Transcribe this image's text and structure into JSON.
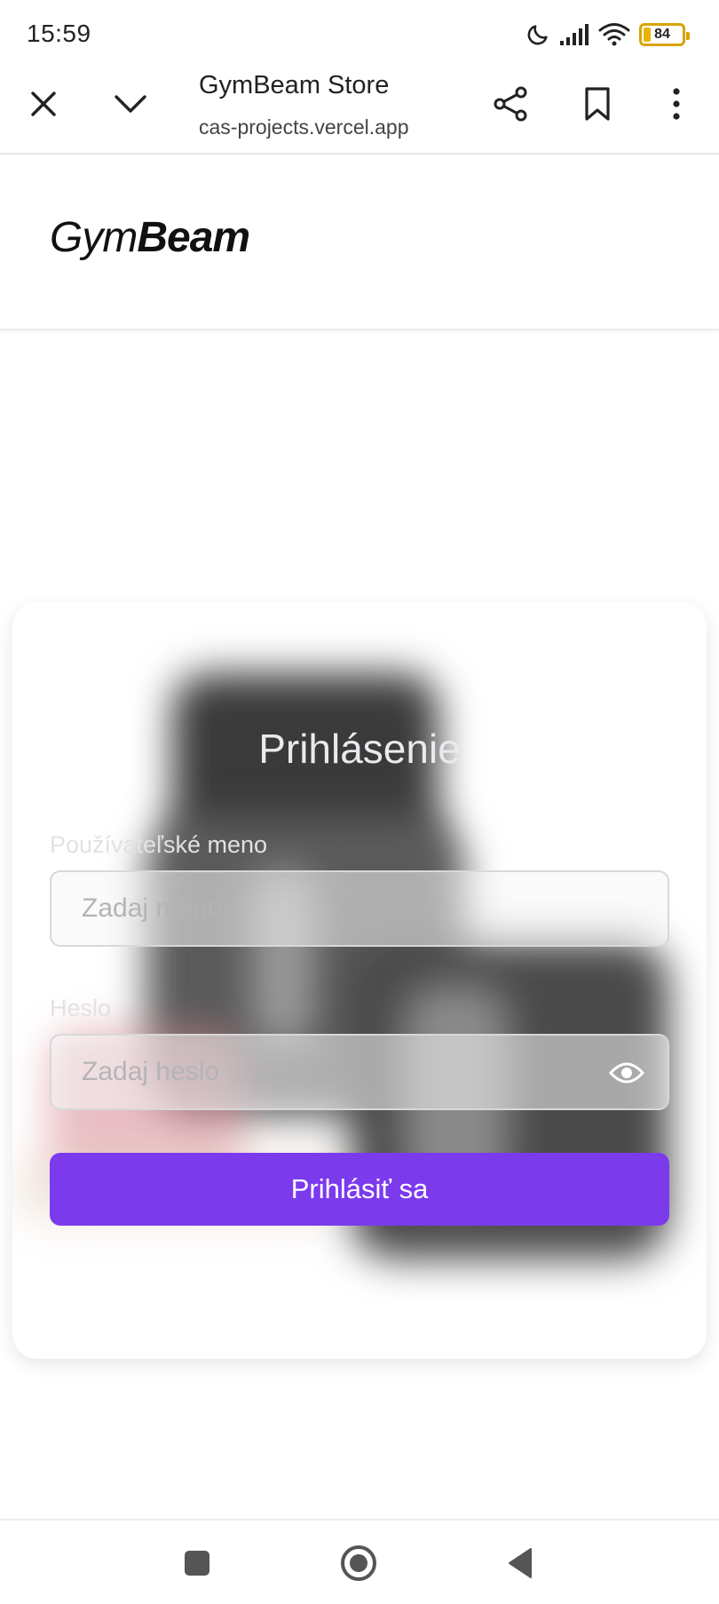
{
  "status_bar": {
    "time": "15:59",
    "battery_level": "84",
    "icons": [
      "moon-icon",
      "signal-icon",
      "wifi-icon",
      "battery-icon"
    ]
  },
  "browser": {
    "page_title": "GymBeam Store",
    "url": "cas-projects.vercel.app",
    "icons": [
      "close-icon",
      "chevron-down-icon",
      "share-icon",
      "bookmark-icon",
      "more-vertical-icon"
    ]
  },
  "site": {
    "logo_light": "Gym",
    "logo_bold": "Beam"
  },
  "login": {
    "title": "Prihlásenie",
    "username_label": "Používateľské meno",
    "username_placeholder": "Zadaj meno",
    "password_label": "Heslo",
    "password_placeholder": "Zadaj heslo",
    "submit_label": "Prihlásiť sa"
  },
  "colors": {
    "accent": "#7c3aed",
    "battery": "#e8b400"
  },
  "nav": {
    "icons": [
      "recents-square-icon",
      "home-circle-icon",
      "back-triangle-icon"
    ]
  }
}
